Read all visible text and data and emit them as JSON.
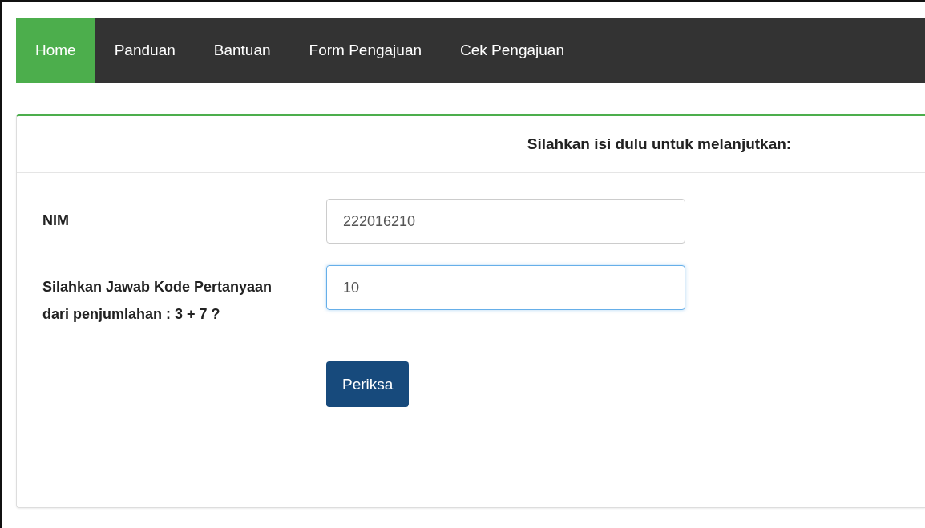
{
  "nav": {
    "items": [
      {
        "label": "Home",
        "selected": true
      },
      {
        "label": "Panduan",
        "selected": false
      },
      {
        "label": "Bantuan",
        "selected": false
      },
      {
        "label": "Form Pengajuan",
        "selected": false
      },
      {
        "label": "Cek Pengajuan",
        "selected": false
      }
    ]
  },
  "card": {
    "title": "Silahkan isi dulu untuk melanjutkan:",
    "fields": [
      {
        "label": "NIM",
        "value": "222016210",
        "focused": false
      },
      {
        "label": "Silahkan Jawab Kode Pertanyaan dari penjumlahan : 3 + 7 ?",
        "value": "10",
        "focused": true
      }
    ],
    "button": "Periksa"
  }
}
